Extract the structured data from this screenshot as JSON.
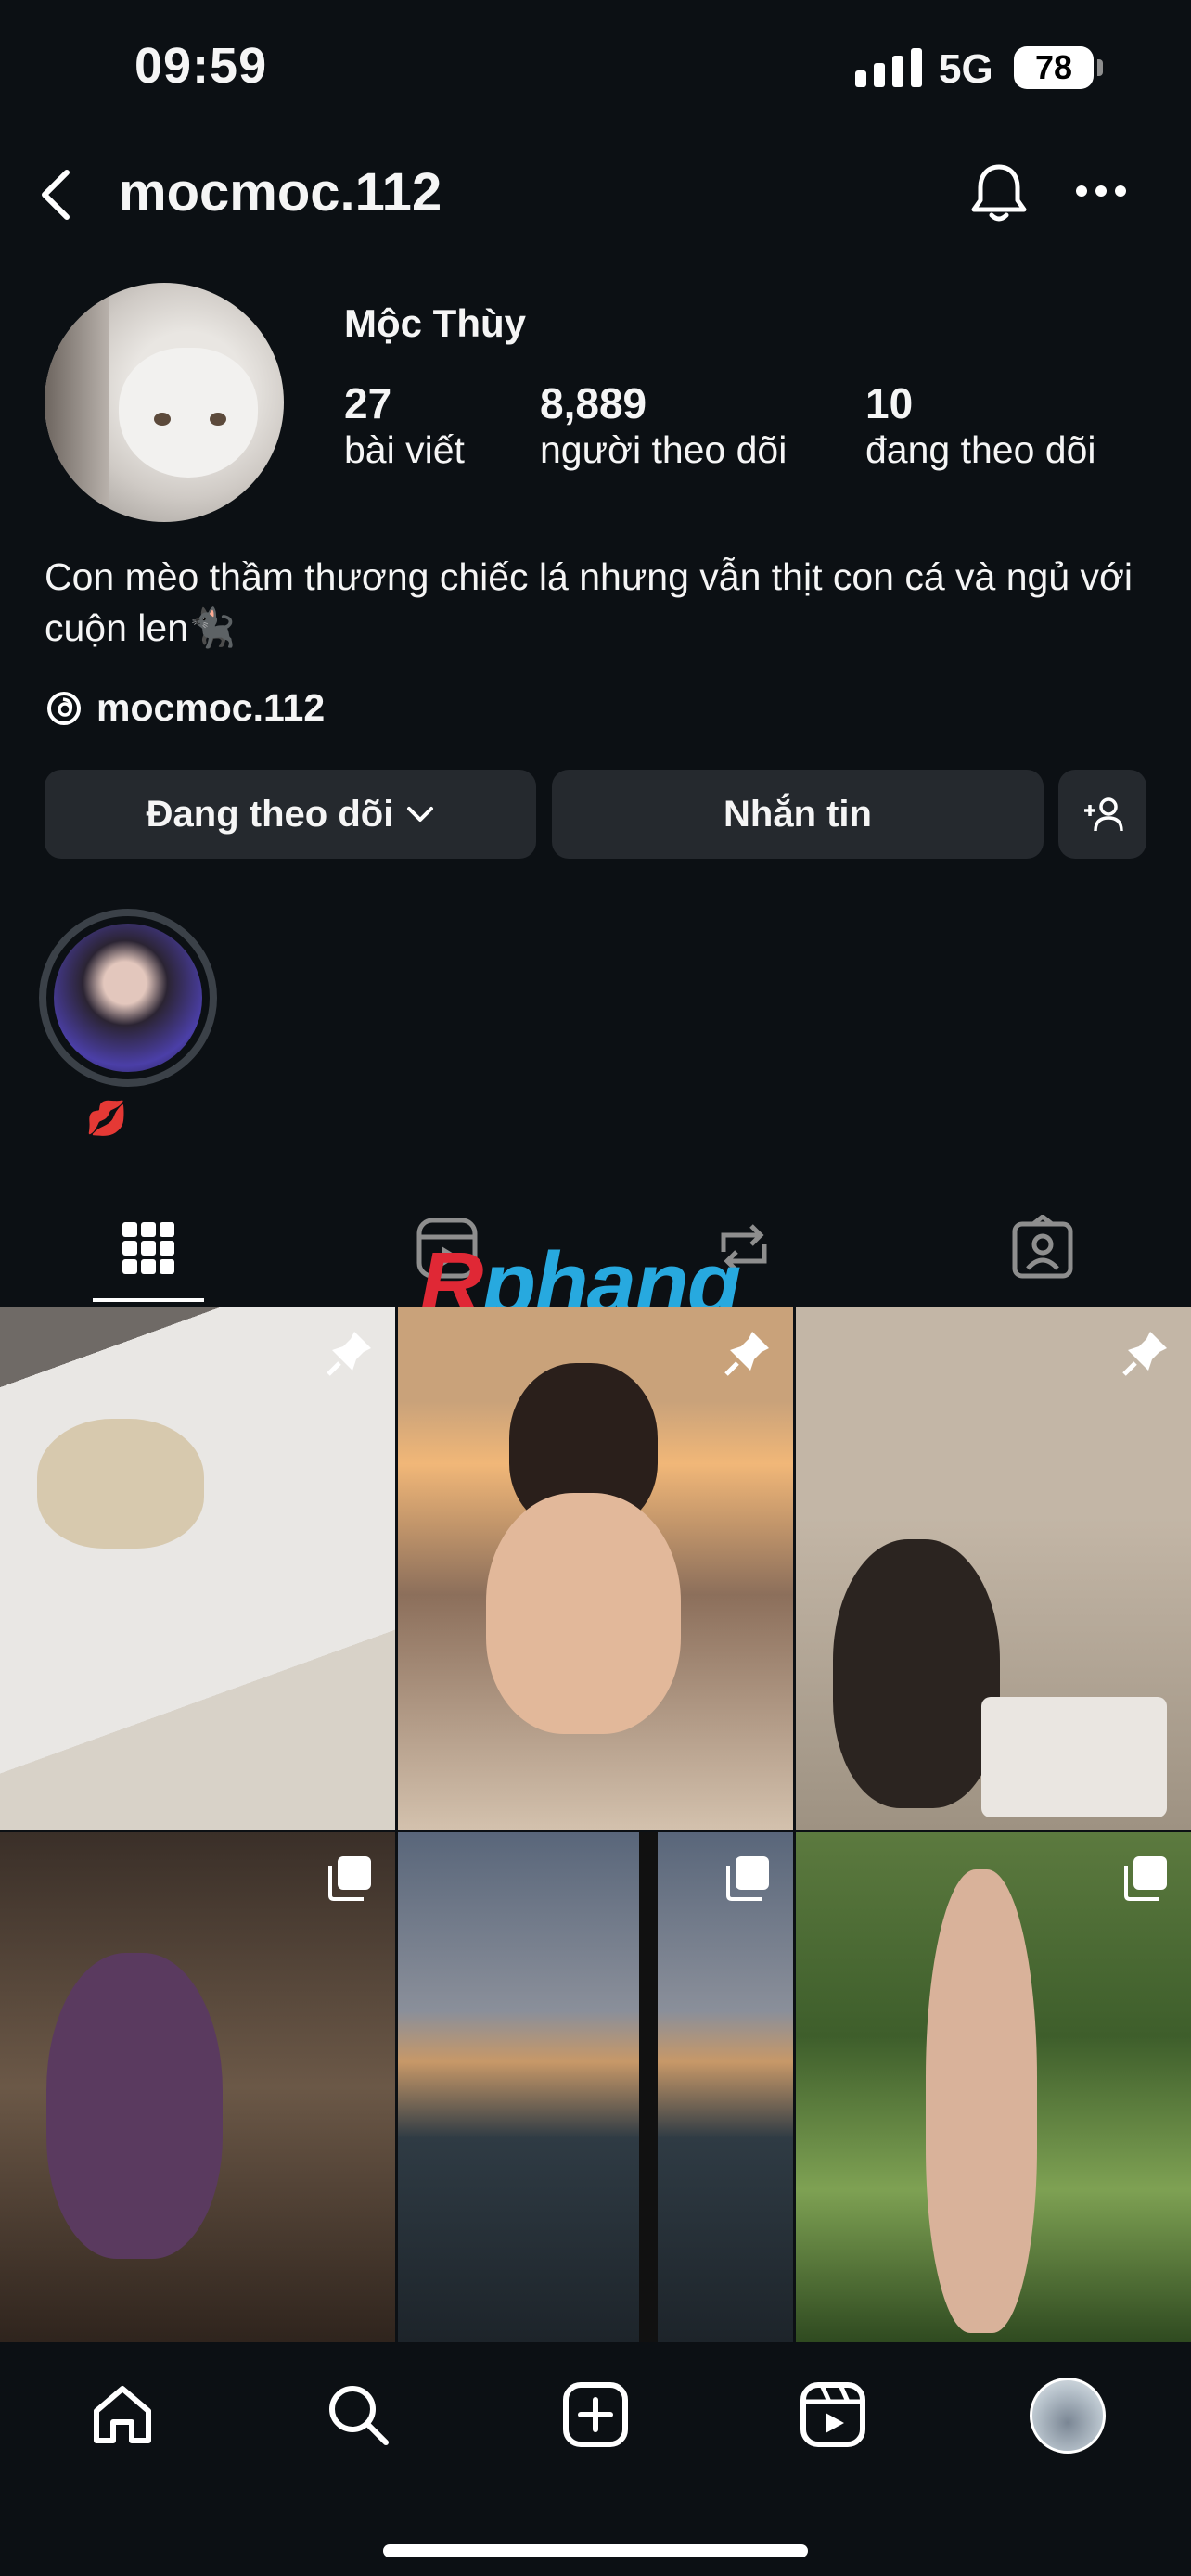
{
  "status": {
    "time": "09:59",
    "network": "5G",
    "battery": "78"
  },
  "header": {
    "username": "mocmoc.112"
  },
  "profile": {
    "display_name": "Mộc Thùy",
    "stats": [
      {
        "value": "27",
        "label": "bài viết"
      },
      {
        "value": "8,889",
        "label": "người theo dõi"
      },
      {
        "value": "10",
        "label": "đang theo dõi"
      }
    ],
    "bio": "Con mèo thầm thương chiếc lá nhưng vẫn thịt con cá và ngủ với cuộn len🐈‍⬛",
    "threads_handle": "mocmoc.112"
  },
  "actions": {
    "following_label": "Đang theo dõi",
    "message_label": "Nhắn tin"
  },
  "highlights": [
    {
      "label": "💋"
    }
  ],
  "tabs": [
    "grid-icon",
    "reels-icon",
    "reposts-icon",
    "tagged-icon"
  ],
  "watermark": {
    "r": "R",
    "rest": "phang"
  },
  "posts": [
    {
      "icon": "pin-icon"
    },
    {
      "icon": "pin-icon"
    },
    {
      "icon": "pin-icon"
    },
    {
      "icon": "carousel-icon"
    },
    {
      "icon": "carousel-icon"
    },
    {
      "icon": "carousel-icon"
    }
  ],
  "colors": {
    "background": "#0c1014",
    "button": "#25292e",
    "text": "#f5f5f5"
  }
}
